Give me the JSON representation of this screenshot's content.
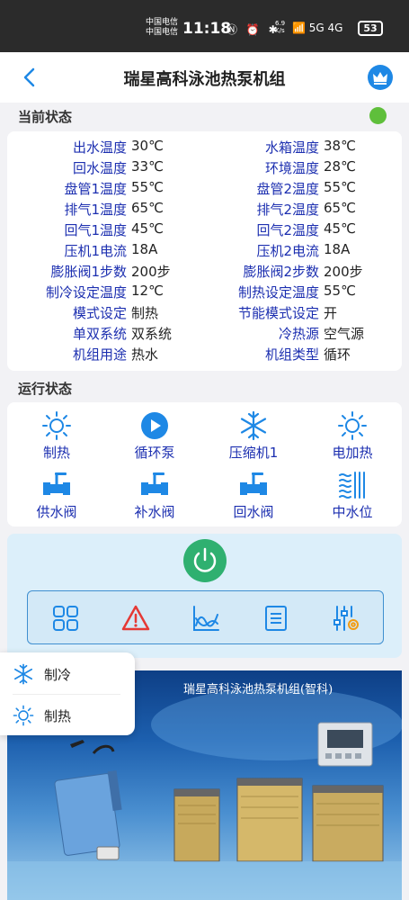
{
  "status_bar": {
    "carrier_line1": "中国电信",
    "carrier_line2": "中国电信",
    "time": "11:18",
    "icons_text": "Ⓝ ⏰ ✱",
    "net_speed_value": "6.9",
    "net_speed_unit": "K/s",
    "signal_text": "📶 5G 4G",
    "battery": "53"
  },
  "header": {
    "title": "瑞星高科泳池热泵机组",
    "back_icon": "chevron-left-icon",
    "crown_icon": "crown-icon"
  },
  "current_status": {
    "heading": "当前状态",
    "online_color": "#5fbf3b",
    "rows": [
      {
        "l1": "出水温度",
        "v1": "30℃",
        "l2": "水箱温度",
        "v2": "38℃"
      },
      {
        "l1": "回水温度",
        "v1": "33℃",
        "l2": "环境温度",
        "v2": "28℃"
      },
      {
        "l1": "盘管1温度",
        "v1": "55℃",
        "l2": "盘管2温度",
        "v2": "55℃"
      },
      {
        "l1": "排气1温度",
        "v1": "65℃",
        "l2": "排气2温度",
        "v2": "65℃"
      },
      {
        "l1": "回气1温度",
        "v1": "45℃",
        "l2": "回气2温度",
        "v2": "45℃"
      },
      {
        "l1": "压机1电流",
        "v1": "18A",
        "l2": "压机2电流",
        "v2": "18A"
      },
      {
        "l1": "膨胀阀1步数",
        "v1": "200步",
        "l2": "膨胀阀2步数",
        "v2": "200步"
      },
      {
        "l1": "制冷设定温度",
        "v1": "12℃",
        "l2": "制热设定温度",
        "v2": "55℃"
      },
      {
        "l1": "模式设定",
        "v1": "制热",
        "l2": "节能模式设定",
        "v2": "开"
      },
      {
        "l1": "单双系统",
        "v1": "双系统",
        "l2": "冷热源",
        "v2": "空气源"
      },
      {
        "l1": "机组用途",
        "v1": "热水",
        "l2": "机组类型",
        "v2": "循环"
      }
    ]
  },
  "run_status": {
    "heading": "运行状态",
    "items": [
      {
        "label": "制热",
        "icon": "sun-icon"
      },
      {
        "label": "循环泵",
        "icon": "play-icon"
      },
      {
        "label": "压缩机1",
        "icon": "snowflake-icon"
      },
      {
        "label": "电加热",
        "icon": "sun-icon"
      },
      {
        "label": "供水阀",
        "icon": "valve-icon"
      },
      {
        "label": "补水阀",
        "icon": "valve-icon"
      },
      {
        "label": "回水阀",
        "icon": "valve-icon"
      },
      {
        "label": "中水位",
        "icon": "water-level-icon"
      }
    ]
  },
  "controls": {
    "power_icon": "power-icon",
    "toolbar": [
      "grid-icon",
      "alarm-icon",
      "chart-icon",
      "list-icon",
      "settings-icon"
    ]
  },
  "mode_menu": {
    "items": [
      {
        "label": "制冷",
        "icon": "snowflake-icon"
      },
      {
        "label": "制热",
        "icon": "sun-icon"
      }
    ]
  },
  "banner": {
    "title": "瑞星高科泳池热泵机组(智科)"
  },
  "colors": {
    "accent_blue": "#1c2fb0",
    "icon_blue": "#1e88e5",
    "power_green": "#2fb070",
    "alarm_red": "#e53935"
  }
}
